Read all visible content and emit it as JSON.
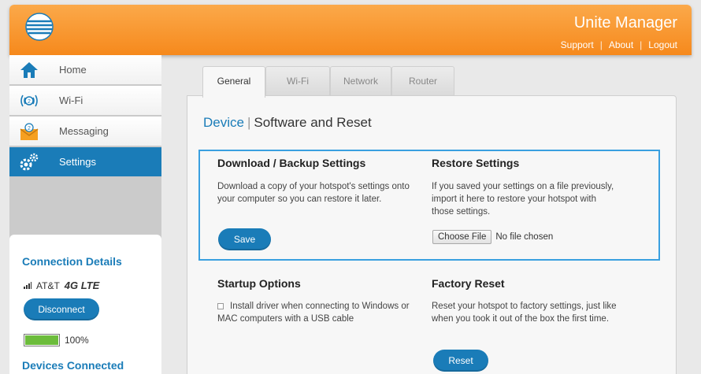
{
  "header": {
    "title": "Unite Manager",
    "links": [
      "Support",
      "About",
      "Logout"
    ]
  },
  "sidebar": {
    "items": [
      {
        "label": "Home",
        "icon": "home-icon"
      },
      {
        "label": "Wi-Fi",
        "icon": "wifi-icon"
      },
      {
        "label": "Messaging",
        "icon": "messaging-icon"
      },
      {
        "label": "Settings",
        "icon": "settings-icon",
        "active": true
      }
    ],
    "connection": {
      "title": "Connection Details",
      "carrier": "AT&T",
      "network": "4G LTE",
      "disconnect_label": "Disconnect",
      "battery": "100%",
      "battery_level": 1.0,
      "devices_title": "Devices Connected"
    }
  },
  "tabs": [
    {
      "label": "General",
      "active": true
    },
    {
      "label": "Wi-Fi"
    },
    {
      "label": "Network"
    },
    {
      "label": "Router"
    }
  ],
  "main": {
    "breadcrumb_link": "Device",
    "breadcrumb_title": "Software and Reset",
    "backup": {
      "title": "Download / Backup Settings",
      "text": "Download a copy of your hotspot's settings onto your computer so you can restore it later.",
      "button": "Save"
    },
    "restore": {
      "title": "Restore Settings",
      "text": "If you saved your settings on a file previously, import it here to restore your hotspot with those settings.",
      "choose_file": "Choose File",
      "no_file": "No file chosen"
    },
    "startup": {
      "title": "Startup Options",
      "checkbox_label": "Install driver when connecting to Windows or MAC computers with a USB cable"
    },
    "factory": {
      "title": "Factory Reset",
      "text": "Reset your hotspot to factory settings, just like when you took it out of the box the first time.",
      "button": "Reset"
    }
  },
  "colors": {
    "brand_orange": "#f6891c",
    "accent_blue": "#1a7cb8",
    "highlight_border": "#3aa0e0",
    "battery_green": "#6cbc3b"
  }
}
